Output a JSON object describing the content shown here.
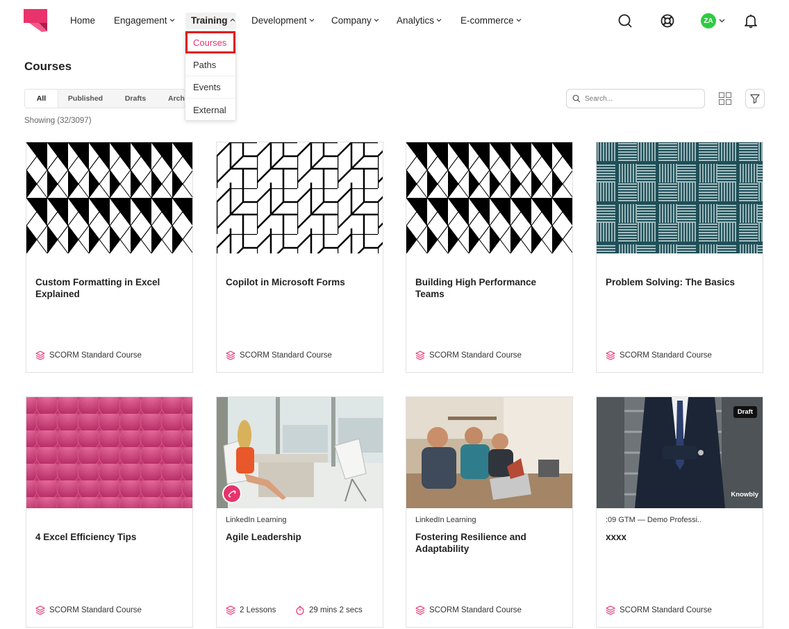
{
  "nav": {
    "items": [
      {
        "label": "Home",
        "has_chevron": false
      },
      {
        "label": "Engagement",
        "has_chevron": true
      },
      {
        "label": "Training",
        "has_chevron": true,
        "active": true
      },
      {
        "label": "Development",
        "has_chevron": true
      },
      {
        "label": "Company",
        "has_chevron": true
      },
      {
        "label": "Analytics",
        "has_chevron": true
      },
      {
        "label": "E-commerce",
        "has_chevron": true
      }
    ],
    "avatar_initials": "ZA",
    "icons": [
      "search-icon",
      "help-lifebuoy-icon",
      "notification-bell-icon"
    ]
  },
  "training_menu": {
    "items": [
      "Courses",
      "Paths",
      "Events",
      "External"
    ],
    "selected": "Courses"
  },
  "page": {
    "title": "Courses",
    "tabs": [
      "All",
      "Published",
      "Drafts",
      "Arch"
    ],
    "active_tab": "All",
    "showing": "Showing (32/3097)",
    "search_placeholder": "Search..."
  },
  "courses": [
    {
      "title": "Custom Formatting in Excel Explained",
      "provider": "",
      "meta": "SCORM Standard Course",
      "thumb": "pattern-triangles"
    },
    {
      "title": "Copilot in Microsoft Forms",
      "provider": "",
      "meta": "SCORM Standard Course",
      "thumb": "pattern-cubes"
    },
    {
      "title": "Building High Performance Teams",
      "provider": "",
      "meta": "SCORM Standard Course",
      "thumb": "pattern-triangles"
    },
    {
      "title": "Problem Solving: The Basics",
      "provider": "",
      "meta": "SCORM Standard Course",
      "thumb": "pattern-weave"
    },
    {
      "title": "4 Excel Efficiency Tips",
      "provider": "",
      "meta": "SCORM Standard Course",
      "thumb": "pattern-scales"
    },
    {
      "title": "Agile Leadership",
      "provider": "LinkedIn Learning",
      "meta": "2 Lessons",
      "duration": "29 mins 2 secs",
      "thumb": "photo-office-woman"
    },
    {
      "title": "Fostering Resilience and Adaptability",
      "provider": "LinkedIn Learning",
      "meta": "SCORM Standard Course",
      "thumb": "photo-team-laptops"
    },
    {
      "title": "xxxx",
      "provider": ":09 GTM — Demo Professi..",
      "meta": "SCORM Standard Course",
      "thumb": "photo-businessman",
      "badge": "Draft",
      "watermark": "Knowbly"
    }
  ],
  "colors": {
    "brand": "#e8336d",
    "highlight": "#e0191f",
    "avatar": "#2ecc40",
    "teal": "#1f4f57"
  }
}
